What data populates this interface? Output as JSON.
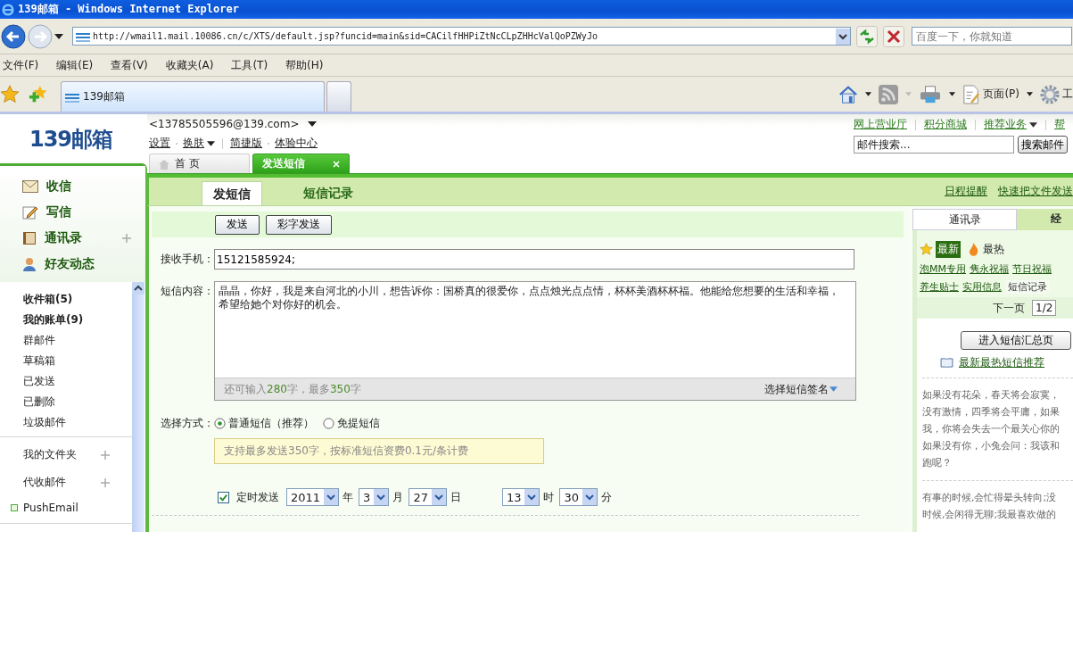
{
  "window": {
    "title": "139邮箱 - Windows Internet Explorer"
  },
  "browser": {
    "address": "http://wmail1.mail.10086.cn/c/XTS/default.jsp?funcid=main&sid=CACilfHHPiZtNcCLpZHHcValQoPZWyJo",
    "search_placeholder": "百度一下，你就知道",
    "menu": [
      "文件(F)",
      "编辑(E)",
      "查看(V)",
      "收藏夹(A)",
      "工具(T)",
      "帮助(H)"
    ],
    "tabs": [
      {
        "label": "139邮箱",
        "selected": true
      }
    ],
    "page_label": "页面(P)",
    "tools_label": "工"
  },
  "header": {
    "logo": "139邮箱",
    "account": "<13785505596@139.com>",
    "links": [
      {
        "label": "设置",
        "dropdown": false
      },
      {
        "label": "换肤",
        "dropdown": true
      },
      {
        "label": "简捷版",
        "dropdown": false
      },
      {
        "label": "体验中心",
        "dropdown": false
      }
    ],
    "top_links": [
      {
        "label": "网上营业厅",
        "dropdown": false
      },
      {
        "label": "积分商城",
        "dropdown": false
      },
      {
        "label": "推荐业务",
        "dropdown": true
      },
      {
        "label": "帮",
        "dropdown": false
      }
    ],
    "search_placeholder": "邮件搜索...",
    "search_button": "搜索邮件"
  },
  "tabs": [
    {
      "label": "首 页",
      "selected": false,
      "closable": false
    },
    {
      "label": "发送短信",
      "selected": true,
      "closable": true
    }
  ],
  "sidebar": {
    "actions": [
      {
        "label": "收信",
        "kind": "inbox",
        "addable": false
      },
      {
        "label": "写信",
        "kind": "compose",
        "addable": false
      },
      {
        "label": "通讯录",
        "kind": "contacts",
        "addable": true
      },
      {
        "label": "好友动态",
        "kind": "friends",
        "addable": false
      }
    ],
    "folders": [
      {
        "label": "收件箱(5)",
        "unread": true
      },
      {
        "label": "我的账单(9)",
        "unread": true
      },
      {
        "label": "群邮件",
        "unread": false
      },
      {
        "label": "草稿箱",
        "unread": false
      },
      {
        "label": "已发送",
        "unread": false
      },
      {
        "label": "已删除",
        "unread": false
      },
      {
        "label": "垃圾邮件",
        "unread": false
      }
    ],
    "groups": [
      {
        "label": "我的文件夹",
        "addable": true
      },
      {
        "label": "代收邮件",
        "addable": true
      }
    ],
    "push": "PushEmail"
  },
  "sms": {
    "subtabs": [
      {
        "label": "发短信",
        "selected": true
      },
      {
        "label": "短信记录",
        "selected": false
      }
    ],
    "right_links": [
      "日程提醒",
      "快速把文件发送"
    ],
    "buttons": [
      "发送",
      "彩字发送"
    ],
    "recipient_label": "接收手机：",
    "recipient": "15121585924;",
    "content_label": "短信内容：",
    "content": "晶晶，你好，我是来自河北的小川，想告诉你：国桥真的很爱你，点点烛光点点情，杯杯美酒杯杯福。他能给您想要的生活和幸福，希望给她个对你好的机会。",
    "counter": [
      {
        "text": "还可输入",
        "highlight": false
      },
      {
        "text": "280",
        "highlight": true
      },
      {
        "text": "字，最多",
        "highlight": false
      },
      {
        "text": "350",
        "highlight": true
      },
      {
        "text": "字",
        "highlight": false
      }
    ],
    "signature": "选择短信签名",
    "method_label": "选择方式：",
    "methods": [
      {
        "label": "普通短信（推荐）",
        "selected": true
      },
      {
        "label": "免提短信",
        "selected": false
      }
    ],
    "hint": "支持最多发送350字，按标准短信资费0.1元/条计费",
    "schedule": {
      "checked": true,
      "label": "定时发送",
      "fields": [
        {
          "value": "2011",
          "unit": "年"
        },
        {
          "value": "3",
          "unit": "月"
        },
        {
          "value": "27",
          "unit": "日"
        },
        {
          "value": "13",
          "unit": "时"
        },
        {
          "value": "30",
          "unit": "分"
        }
      ]
    }
  },
  "panel": {
    "tabs": [
      {
        "label": "通讯录",
        "selected": false
      },
      {
        "label": "经",
        "selected": true
      }
    ],
    "filters": [
      {
        "label": "最新",
        "selected": true,
        "kind": "star"
      },
      {
        "label": "最热",
        "selected": false,
        "kind": "flame"
      }
    ],
    "categories": [
      [
        {
          "label": "泡MM专用",
          "selected": false
        },
        {
          "label": "隽永祝福",
          "selected": false
        },
        {
          "label": "节日祝福",
          "selected": false
        }
      ],
      [
        {
          "label": "养生贴士",
          "selected": false
        },
        {
          "label": "实用信息",
          "selected": false
        },
        {
          "label": "短信记录",
          "selected": true
        }
      ]
    ],
    "next": "下一页",
    "page": "1/2",
    "button": "进入短信汇总页",
    "link": "最新最热短信推荐",
    "messages": [
      {
        "lines": [
          "如果没有花朵，春天将会寂寞，",
          "没有激情，四季将会平庸，如果",
          "我，你将会失去一个最关心你的",
          "如果没有你，小兔会问：我该和",
          "跑呢？"
        ]
      },
      {
        "lines": [
          "有事的时候,会忙得晕头转向;没",
          "时候,会闲得无聊;我最喜欢做的"
        ]
      }
    ]
  }
}
